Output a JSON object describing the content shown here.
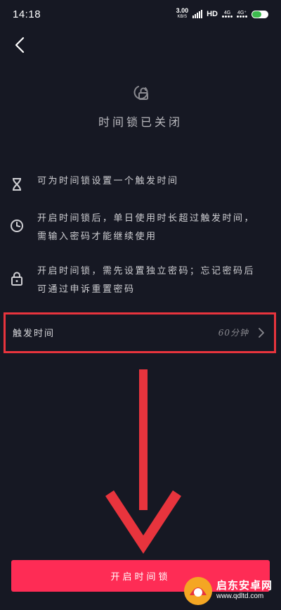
{
  "status_bar": {
    "time": "14:18",
    "speed_value": "3.00",
    "speed_unit": "KB/S",
    "hd_label": "HD",
    "net_labels": [
      "4G",
      "4G⁺"
    ]
  },
  "header": {
    "back_icon": "chevron-left-icon",
    "title": "时间锁已关闭"
  },
  "info_items": [
    {
      "icon": "hourglass-icon",
      "text": "可为时间锁设置一个触发时间"
    },
    {
      "icon": "clock-icon",
      "text_line1": "开启时间锁后，单日使用时长超过触发时间，",
      "text_line2": "需输入密码才能继续使用"
    },
    {
      "icon": "lock-icon",
      "text_line1": "开启时间锁，需先设置独立密码；忘记密码后",
      "text_line2": "可通过申诉重置密码"
    }
  ],
  "trigger_time": {
    "label": "触发时间",
    "value": "60分钟"
  },
  "primary_button": {
    "label": "开启时间锁"
  },
  "watermark": {
    "name": "启东安卓网",
    "url": "www.qdltd.com"
  },
  "colors": {
    "background": "#161823",
    "accent": "#fe2c55",
    "annotation_red": "#e8343d"
  }
}
